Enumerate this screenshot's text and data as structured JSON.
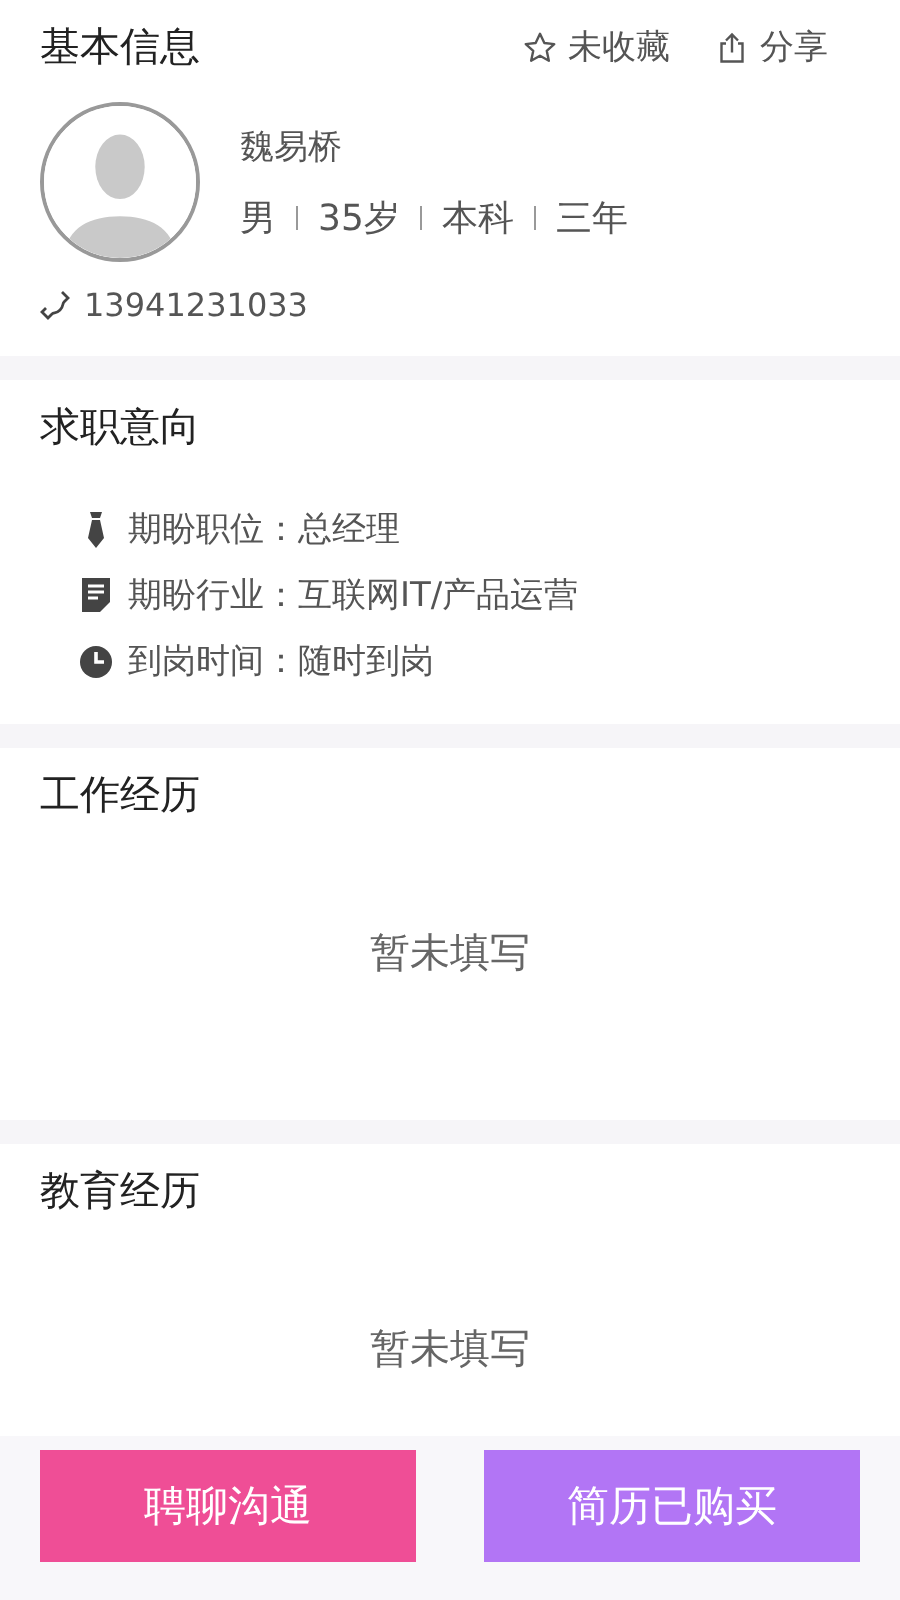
{
  "basic_info": {
    "title": "基本信息",
    "actions": [
      {
        "kind": "favorite",
        "label": "未收藏",
        "favorited": false
      },
      {
        "kind": "share",
        "label": "分享"
      }
    ],
    "name": "魏易桥",
    "facts": [
      "男",
      "35岁",
      "本科",
      "三年"
    ],
    "phone": "13941231033"
  },
  "job_intent": {
    "title": "求职意向",
    "items": [
      {
        "kind": "position",
        "text": "期盼职位：总经理"
      },
      {
        "kind": "industry",
        "text": "期盼行业：互联网IT/产品运营"
      },
      {
        "kind": "time",
        "text": "到岗时间：随时到岗"
      }
    ]
  },
  "sections": [
    {
      "title": "工作经历",
      "empty_text": "暂未填写"
    },
    {
      "title": "教育经历",
      "empty_text": "暂未填写"
    }
  ],
  "buttons": [
    {
      "label": "聘聊沟通",
      "color": "#ef4e96"
    },
    {
      "label": "简历已购买",
      "color": "#b275f5"
    }
  ]
}
